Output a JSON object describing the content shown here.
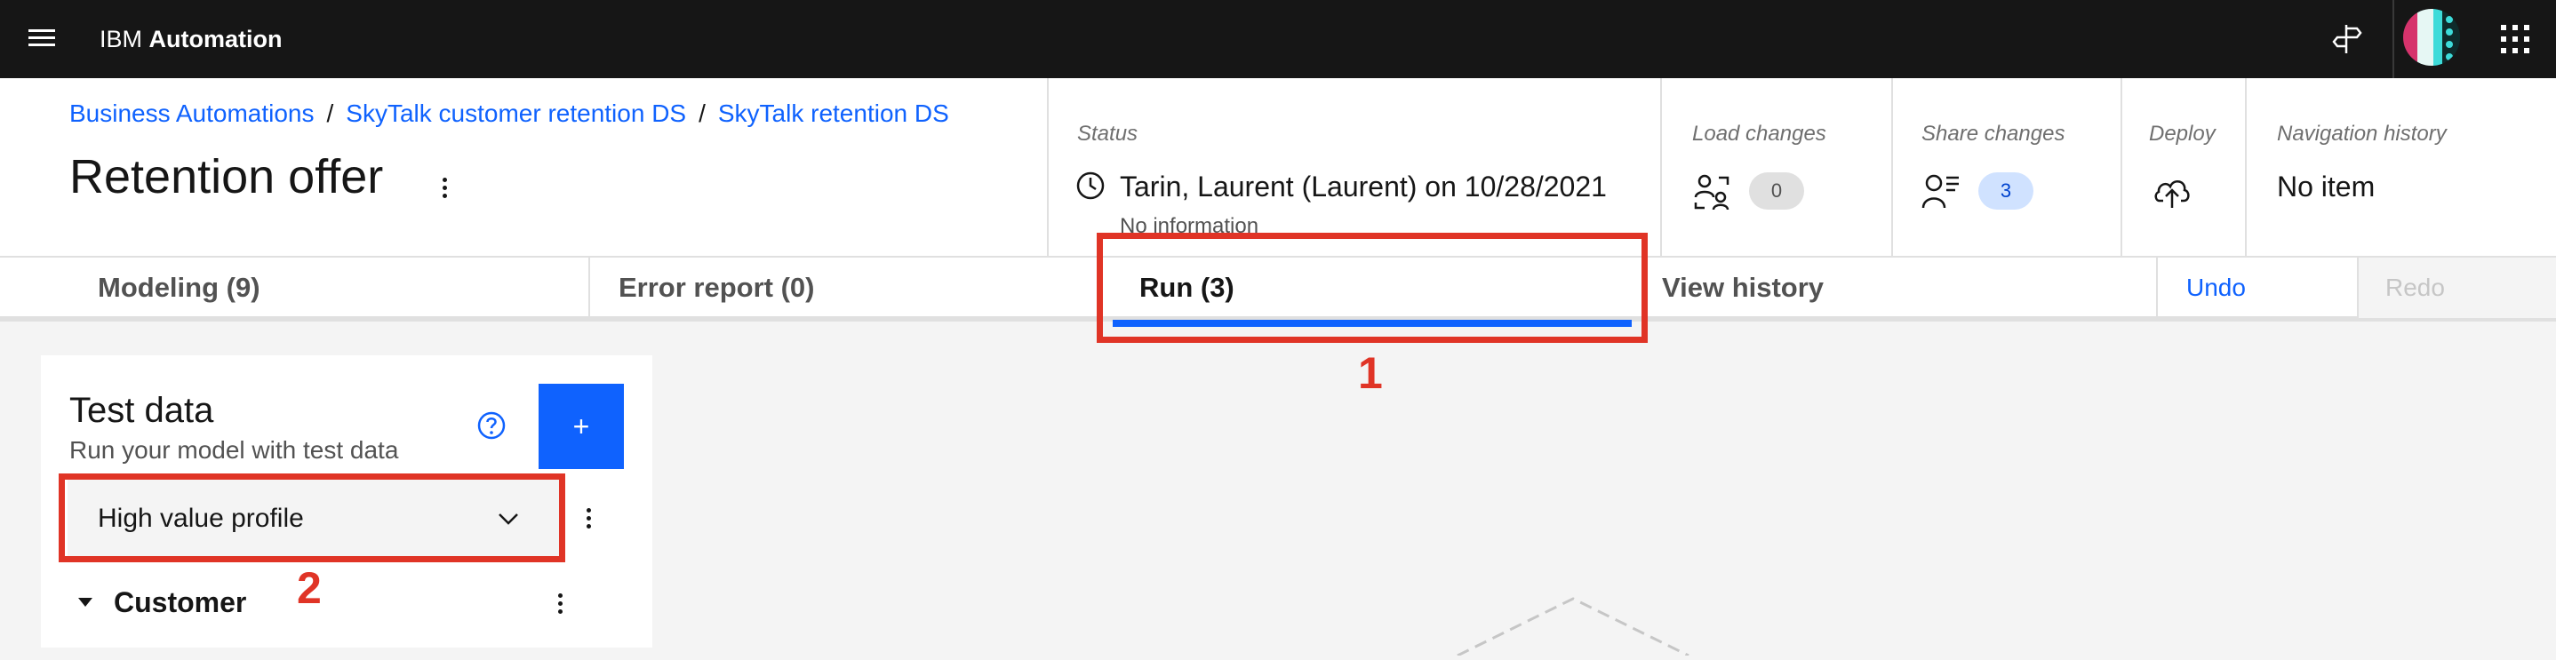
{
  "topbar": {
    "brand_prefix": "IBM",
    "brand_name": "Automation",
    "icons": [
      "menu-icon",
      "help-icon",
      "avatar",
      "app-switcher-icon"
    ]
  },
  "header": {
    "breadcrumb": [
      "Business Automations",
      "SkyTalk customer retention DS",
      "SkyTalk retention DS"
    ],
    "breadcrumb_separator": "/",
    "title": "Retention offer"
  },
  "status": {
    "label": "Status",
    "value": "Tarin, Laurent (Laurent) on 10/28/2021",
    "sub": "No information"
  },
  "load_changes": {
    "label": "Load changes",
    "count": "0"
  },
  "share_changes": {
    "label": "Share changes",
    "count": "3"
  },
  "deploy": {
    "label": "Deploy"
  },
  "nav_history": {
    "label": "Navigation history",
    "value": "No item"
  },
  "tabs": [
    {
      "label": "Modeling (9)"
    },
    {
      "label": "Error report (0)"
    },
    {
      "label": "Run (3)",
      "active": true
    },
    {
      "label": "View history"
    },
    {
      "label": "Undo"
    },
    {
      "label": "Redo"
    }
  ],
  "callouts": [
    "1",
    "2"
  ],
  "test_data": {
    "title": "Test data",
    "subtitle": "Run your model with test data",
    "add_label": "+",
    "selected_profile": "High value profile",
    "section": "Customer"
  },
  "colors": {
    "accent": "#0f62fe",
    "callout": "#e03426",
    "topbar": "#161616"
  }
}
